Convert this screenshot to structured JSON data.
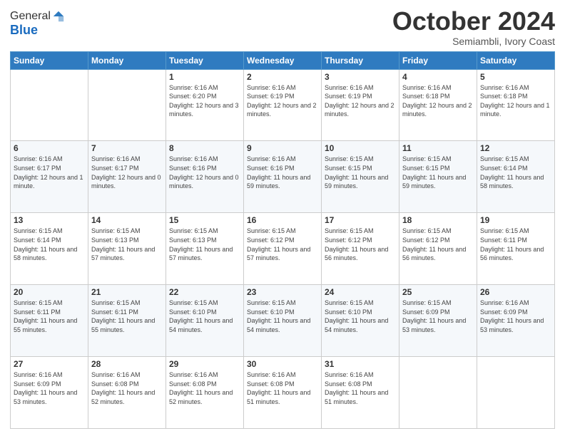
{
  "header": {
    "logo_general": "General",
    "logo_blue": "Blue",
    "month": "October 2024",
    "location": "Semiambli, Ivory Coast"
  },
  "days_of_week": [
    "Sunday",
    "Monday",
    "Tuesday",
    "Wednesday",
    "Thursday",
    "Friday",
    "Saturday"
  ],
  "weeks": [
    [
      {
        "day": "",
        "info": ""
      },
      {
        "day": "",
        "info": ""
      },
      {
        "day": "1",
        "info": "Sunrise: 6:16 AM\nSunset: 6:20 PM\nDaylight: 12 hours and 3 minutes."
      },
      {
        "day": "2",
        "info": "Sunrise: 6:16 AM\nSunset: 6:19 PM\nDaylight: 12 hours and 2 minutes."
      },
      {
        "day": "3",
        "info": "Sunrise: 6:16 AM\nSunset: 6:19 PM\nDaylight: 12 hours and 2 minutes."
      },
      {
        "day": "4",
        "info": "Sunrise: 6:16 AM\nSunset: 6:18 PM\nDaylight: 12 hours and 2 minutes."
      },
      {
        "day": "5",
        "info": "Sunrise: 6:16 AM\nSunset: 6:18 PM\nDaylight: 12 hours and 1 minute."
      }
    ],
    [
      {
        "day": "6",
        "info": "Sunrise: 6:16 AM\nSunset: 6:17 PM\nDaylight: 12 hours and 1 minute."
      },
      {
        "day": "7",
        "info": "Sunrise: 6:16 AM\nSunset: 6:17 PM\nDaylight: 12 hours and 0 minutes."
      },
      {
        "day": "8",
        "info": "Sunrise: 6:16 AM\nSunset: 6:16 PM\nDaylight: 12 hours and 0 minutes."
      },
      {
        "day": "9",
        "info": "Sunrise: 6:16 AM\nSunset: 6:16 PM\nDaylight: 11 hours and 59 minutes."
      },
      {
        "day": "10",
        "info": "Sunrise: 6:15 AM\nSunset: 6:15 PM\nDaylight: 11 hours and 59 minutes."
      },
      {
        "day": "11",
        "info": "Sunrise: 6:15 AM\nSunset: 6:15 PM\nDaylight: 11 hours and 59 minutes."
      },
      {
        "day": "12",
        "info": "Sunrise: 6:15 AM\nSunset: 6:14 PM\nDaylight: 11 hours and 58 minutes."
      }
    ],
    [
      {
        "day": "13",
        "info": "Sunrise: 6:15 AM\nSunset: 6:14 PM\nDaylight: 11 hours and 58 minutes."
      },
      {
        "day": "14",
        "info": "Sunrise: 6:15 AM\nSunset: 6:13 PM\nDaylight: 11 hours and 57 minutes."
      },
      {
        "day": "15",
        "info": "Sunrise: 6:15 AM\nSunset: 6:13 PM\nDaylight: 11 hours and 57 minutes."
      },
      {
        "day": "16",
        "info": "Sunrise: 6:15 AM\nSunset: 6:12 PM\nDaylight: 11 hours and 57 minutes."
      },
      {
        "day": "17",
        "info": "Sunrise: 6:15 AM\nSunset: 6:12 PM\nDaylight: 11 hours and 56 minutes."
      },
      {
        "day": "18",
        "info": "Sunrise: 6:15 AM\nSunset: 6:12 PM\nDaylight: 11 hours and 56 minutes."
      },
      {
        "day": "19",
        "info": "Sunrise: 6:15 AM\nSunset: 6:11 PM\nDaylight: 11 hours and 56 minutes."
      }
    ],
    [
      {
        "day": "20",
        "info": "Sunrise: 6:15 AM\nSunset: 6:11 PM\nDaylight: 11 hours and 55 minutes."
      },
      {
        "day": "21",
        "info": "Sunrise: 6:15 AM\nSunset: 6:11 PM\nDaylight: 11 hours and 55 minutes."
      },
      {
        "day": "22",
        "info": "Sunrise: 6:15 AM\nSunset: 6:10 PM\nDaylight: 11 hours and 54 minutes."
      },
      {
        "day": "23",
        "info": "Sunrise: 6:15 AM\nSunset: 6:10 PM\nDaylight: 11 hours and 54 minutes."
      },
      {
        "day": "24",
        "info": "Sunrise: 6:15 AM\nSunset: 6:10 PM\nDaylight: 11 hours and 54 minutes."
      },
      {
        "day": "25",
        "info": "Sunrise: 6:15 AM\nSunset: 6:09 PM\nDaylight: 11 hours and 53 minutes."
      },
      {
        "day": "26",
        "info": "Sunrise: 6:16 AM\nSunset: 6:09 PM\nDaylight: 11 hours and 53 minutes."
      }
    ],
    [
      {
        "day": "27",
        "info": "Sunrise: 6:16 AM\nSunset: 6:09 PM\nDaylight: 11 hours and 53 minutes."
      },
      {
        "day": "28",
        "info": "Sunrise: 6:16 AM\nSunset: 6:08 PM\nDaylight: 11 hours and 52 minutes."
      },
      {
        "day": "29",
        "info": "Sunrise: 6:16 AM\nSunset: 6:08 PM\nDaylight: 11 hours and 52 minutes."
      },
      {
        "day": "30",
        "info": "Sunrise: 6:16 AM\nSunset: 6:08 PM\nDaylight: 11 hours and 51 minutes."
      },
      {
        "day": "31",
        "info": "Sunrise: 6:16 AM\nSunset: 6:08 PM\nDaylight: 11 hours and 51 minutes."
      },
      {
        "day": "",
        "info": ""
      },
      {
        "day": "",
        "info": ""
      }
    ]
  ]
}
